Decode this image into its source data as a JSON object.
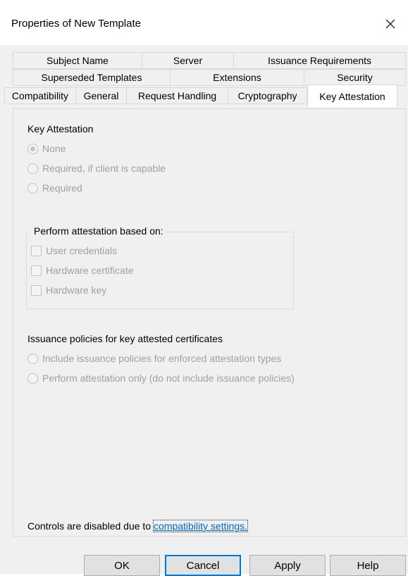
{
  "window": {
    "title": "Properties of New Template",
    "close_glyph": "✕"
  },
  "tabs": {
    "row1": [
      "Subject Name",
      "Server",
      "Issuance Requirements"
    ],
    "row2": [
      "Superseded Templates",
      "Extensions",
      "Security"
    ],
    "row3": [
      "Compatibility",
      "General",
      "Request Handling",
      "Cryptography",
      "Key Attestation"
    ],
    "selected": "Key Attestation"
  },
  "key_attestation": {
    "heading": "Key Attestation",
    "options": [
      "None",
      "Required, if client is capable",
      "Required"
    ],
    "selected_option": "None"
  },
  "attestation_group": {
    "title": "Perform attestation based on:",
    "checks": [
      "User credentials",
      "Hardware certificate",
      "Hardware key"
    ]
  },
  "issuance_policies": {
    "heading": "Issuance policies for key attested certificates",
    "options": [
      "Include issuance policies for enforced attestation types",
      "Perform attestation only (do not include issuance policies)"
    ]
  },
  "footer_note": {
    "text": "Controls are disabled due to ",
    "link": "compatibility settings."
  },
  "buttons": {
    "ok": "OK",
    "cancel": "Cancel",
    "apply": "Apply",
    "help": "Help"
  },
  "colors": {
    "link": "#0066cc",
    "disabled_text": "#a0a0a0",
    "focus_border": "#0078d7"
  }
}
